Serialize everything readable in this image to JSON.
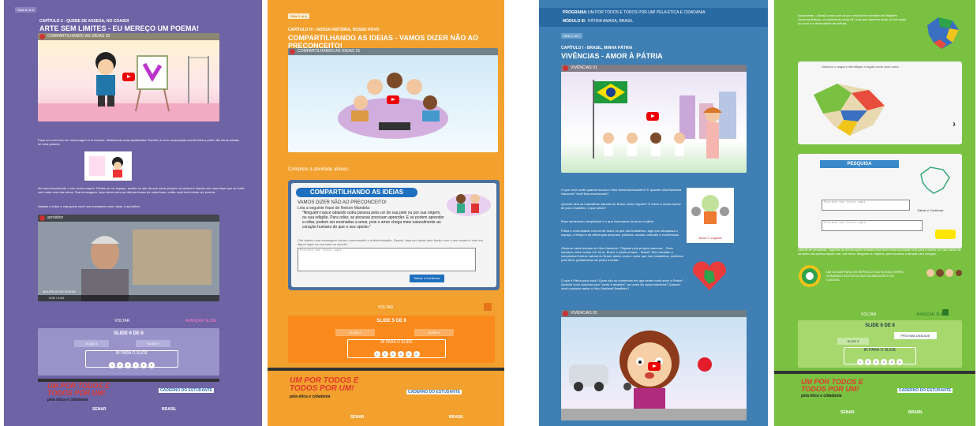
{
  "p1": {
    "slide": "Slide 6 de 6",
    "chapter": "CAPÍTULO 2 - QUEBE DE ASSESA, NO COASOI",
    "title": "ARTE SEM LIMITES - EU MEREÇO UM POEMA!",
    "video1": "COMPARTILHANDO AS IDEIAS 02",
    "para1": "Faça um exercício em homenagem a si mesmo, destacando suas qualidades. Escolha é uma composição escrita feita a partir das letras iniciais de uma palavra.",
    "para2": "No caso envolvendo o seu nome próprio. Divirta-se, no espaço, escrito no site da sua nome próprio na vertical e depois crie uma frase que se inicie com cada uma das letras. Sua mensagem, faça rimas entre as últimas frases de cada frase, então você terá criado um poema.",
    "para3": "Assista o vídeo e veja quem você nos ensinando como fazer o acróstico!",
    "video2": "acróstico",
    "time": "0:00 / 2:04",
    "badge": "MAURÍCIO DE SOUSA",
    "prev": "VOLTAR",
    "next": "AVANÇAR SLIDE",
    "nav_title": "SLIDE 6 DE 6",
    "s4": "SLIDE 4",
    "s5": "SLIDE 5",
    "jump": "IR PARA O SLIDE",
    "dots": [
      "1",
      "2",
      "3",
      "4",
      "5",
      "6"
    ],
    "brand1": "UM POR TODOS E TODOS POR UM!",
    "brand2": "pela ética e cidadania",
    "caderno": "CADERNO DO ESTUDANTE",
    "partners": [
      "SENAR",
      "BRASIL"
    ]
  },
  "p2": {
    "slide": "Slide 5 de 6",
    "chapter": "CAPÍTULO IV - NOSSA HISTÓRIA, NOSSO POVO",
    "title": "COMPARTILHANDO AS IDEIAS - VAMOS DIZER NÃO AO PRECONCEITO!",
    "video": "COMPARTILHANDO AS IDEIAS 01",
    "complete": "Complete a atividade abaixo.",
    "card_title": "COMPARTILHANDO AS IDEIAS",
    "card_sub": "VAMOS DIZER NÃO AO PRECONCEITO!",
    "card_lead": "Leia a seguinte frase de Nelson Mandela:",
    "quote": "\"Ninguém nasce odiando outra pessoa pela cor de sua pele ou por sua origem, ou sua religião. Para odiar, as pessoas precisam aprender. E se podem aprender a odiar, podem ser ensinadas a amar, pois o amor chega mais naturalmente ao coração humano do que o seu oposto.\"",
    "card_hint": "Crie abaixo uma mensagem contra o preconceito e a discriminação. Depois, faça um cartaz bem bonito com o seu recado e cole em algum lugar na sua casa ou escola!",
    "placeholder": "Escreva seu texto aqui.",
    "save": "Salvar e Continuar",
    "prev": "VOLTAR",
    "nav_title": "SLIDE 5 DE 6",
    "s4": "SLIDE 4",
    "s6": "SLIDE 6",
    "jump": "IR PARA O SLIDE",
    "dots": [
      "1",
      "2",
      "3",
      "4",
      "5",
      "6"
    ],
    "brand1": "UM POR TODOS E TODOS POR UM!",
    "brand2": "pela ética e cidadania",
    "caderno": "CADERNO DO ESTUDANTE",
    "partners": [
      "SENAR",
      "BRASIL"
    ]
  },
  "p3": {
    "prog_label": "PROGRAMA:",
    "prog": "UM POR TODOS E TODOS POR UM! PELA ÉTICA E CIDADANIA",
    "mod_label": "MÓDULO III:",
    "mod": "PÁTRIA AMADA, BRASIL",
    "slide": "Slide 1 de 7",
    "chapter": "CAPÍTULO I - BRASIL, MINHA PÁTRIA",
    "title": "VIVÊNCIAS - AMOR À PÁTRIA",
    "video1": "VIVÊNCIAS 01",
    "q1": "O que você sente quando escuta o Hino Nacional Brasileiro? E quando olha Bandeira Nacional? Você fica emocionado?",
    "q2": "Quando olha as maravilhas naturais do Brasil, sente orgulho? E sobre a nossa época de povo brasileiro, o que sente?",
    "q3": "Esse sentimento inexplicável é o que chamamos de amor à pátria.",
    "q4": "Pátria é a identidade comum de todos os que são brasileiros, algo que ultrapassa o espaço, o tempo e as diferenças pessoais, políticas, sociais, culturais e econômicas.",
    "q5": "Observe estes trechos do Hino Nacional: \"Gigante pela própria natureza... Terra adorada, entre outras mil, és tu, Brasil, ó pátria amada... Brasil!\" Eles retratam a inexplicável beleza natural do Brasil, assim como o amor que nós, brasileiros, sentimos pela terra, gostaríamos de poder mostrar.",
    "q6": "O que é Pátria para você? Quais são os momentos em que sente muito amor à Pátria? Quando você costuma usar \"verde e amarelo\", as cores da nossa bandeira? Quando você costuma cantar o Hino Nacional Brasileiro?",
    "video2": "VIVÊNCIAS 02",
    "sticker": "Brasil O Gigante"
  },
  "p4": {
    "intro": "Atualmente, o Brasil conta com cinco e está forme também as Regiões Geoeconômicas, considerando cada UF, mas que também tanto na formação do povo e a diversidade da cultura.",
    "map_caption": "Observe o mapa e identifique a região onde você mora.",
    "pesquisa": "PESQUISA",
    "placeholder": "Escreva seu texto aqui.",
    "save": "Salvar e Continuar",
    "para": "Depois de pesquisar, organize as informações obtidas para fazer uma exposição oral para a turma, em um cartaz de tamanho da apresentação oral, use fotos, imagens ou objetos, para mostrar a atração dos colegas.",
    "seal_text": "UM OLHAR PARA OS SERVIÇOS DA NOSSA TERRA, SOMANDO ÀS ESCOLHAS DA AMIZADE E DO COLEGA.",
    "prev": "VOLTAR",
    "next": "AVANÇAR SLIDE",
    "nav_title": "SLIDE 6 DE 8",
    "s5": "SLIDE 5",
    "s7": "PRÓXIMA UNIDADE",
    "jump": "IR PARA O SLIDE",
    "dots": [
      "1",
      "2",
      "3",
      "4",
      "5",
      "6"
    ],
    "brand1": "UM POR TODOS E TODOS POR UM!",
    "brand2": "pela ética e cidadania",
    "caderno": "CADERNO DO ESTUDANTE",
    "partners": [
      "SENAR",
      "BRASIL"
    ]
  }
}
